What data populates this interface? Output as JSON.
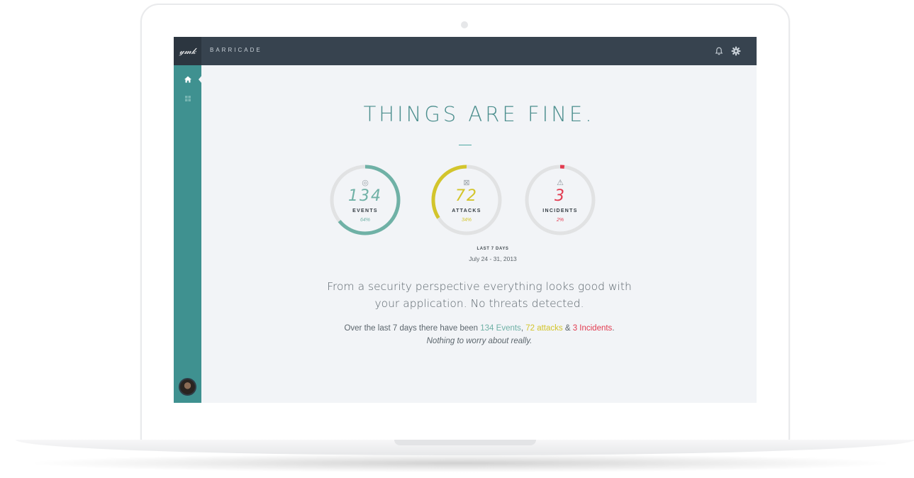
{
  "app": {
    "brand": "BARRICADE",
    "logo_text": "𝓎𝓂𝓀"
  },
  "colors": {
    "teal": "#6fb1a6",
    "yellow": "#d3c52c",
    "red": "#e23b50",
    "track": "#e1e2e3",
    "sidebar": "#3f9190",
    "topbar": "#37434f"
  },
  "topbar": {
    "icons": [
      "bell-icon",
      "gear-icon"
    ]
  },
  "sidebar": {
    "items": [
      "home-icon",
      "grid-icon"
    ]
  },
  "headline": "THINGS ARE FINE.",
  "gauges": [
    {
      "value": "134",
      "label": "EVENTS",
      "percent": "64%",
      "fraction": 0.64,
      "icon": "target-icon",
      "icon_glyph": "◎",
      "color": "#6fb1a6"
    },
    {
      "value": "72",
      "label": "ATTACKS",
      "percent": "34%",
      "fraction": 0.34,
      "icon": "cross-box-icon",
      "icon_glyph": "⊠",
      "color": "#d3c52c"
    },
    {
      "value": "3",
      "label": "INCIDENTS",
      "percent": "2%",
      "fraction": 0.02,
      "icon": "warning-icon",
      "icon_glyph": "⚠",
      "color": "#e23b50"
    }
  ],
  "period": {
    "label": "LAST 7 DAYS",
    "range": "July 24 - 31, 2013"
  },
  "summary": "From a security perspective everything looks good with your application. No threats detected.",
  "detail": {
    "prefix": "Over the last 7 days there have been ",
    "events": "134 Events",
    "sep1": ", ",
    "attacks": "72 attacks",
    "sep2": " & ",
    "incidents": "3 Incidents",
    "suffix": ".",
    "sub": "Nothing to worry about really."
  }
}
